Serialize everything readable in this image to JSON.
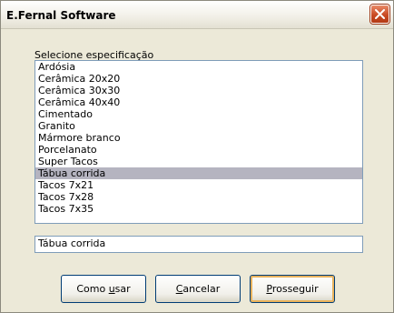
{
  "window": {
    "title": "E.Fernal Software"
  },
  "list": {
    "label": "Selecione especificação",
    "items": [
      "Ardósia",
      "Cerâmica 20x20",
      "Cerâmica 30x30",
      "Cerâmica 40x40",
      "Cimentado",
      "Granito",
      "Mármore branco",
      "Porcelanato",
      "Super Tacos",
      "Tábua corrida",
      "Tacos 7x21",
      "Tacos 7x28",
      "Tacos 7x35"
    ],
    "selected_index": 9
  },
  "selection_field": {
    "value": "Tábua corrida"
  },
  "buttons": {
    "como_usar_pre": "Como ",
    "como_usar_mn": "u",
    "como_usar_post": "sar",
    "cancelar_mn": "C",
    "cancelar_post": "ancelar",
    "prosseguir_mn": "P",
    "prosseguir_post": "rosseguir"
  },
  "colors": {
    "selection": "#b5b4c0",
    "close_button": "#c94a23",
    "border_blue": "#7f9db9"
  }
}
